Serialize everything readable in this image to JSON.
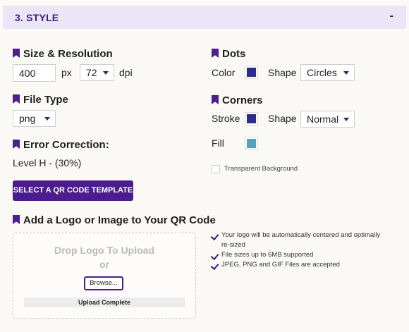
{
  "header": {
    "title": "3. STYLE",
    "collapse": "-"
  },
  "size_resolution": {
    "title": "Size & Resolution",
    "size_value": "400",
    "size_unit": "px",
    "dpi_value": "72",
    "dpi_unit": "dpi"
  },
  "file_type": {
    "title": "File Type",
    "value": "png"
  },
  "error_correction": {
    "title": "Error Correction:",
    "value": "Level H - (30%)"
  },
  "template_button": "SELECT A QR CODE TEMPLATE",
  "dots": {
    "title": "Dots",
    "color_label": "Color",
    "color": "#2e2b8f",
    "shape_label": "Shape",
    "shape_value": "Circles"
  },
  "corners": {
    "title": "Corners",
    "stroke_label": "Stroke",
    "stroke_color": "#2e2b8f",
    "shape_label": "Shape",
    "shape_value": "Normal",
    "fill_label": "Fill",
    "fill_color": "#56a0c0"
  },
  "transparent_background": {
    "label": "Transparent Background",
    "checked": false
  },
  "logo": {
    "title": "Add a Logo or Image to Your QR Code",
    "drop_title": "Drop Logo To Upload",
    "drop_or": "or",
    "browse_label": "Browse...",
    "upload_status": "Upload Complete",
    "info": [
      "Your logo will be automatically centered and optimally re-sized",
      "File sizes up to 6MB supported",
      "JPEG, PNG and GIF Files are accepted"
    ]
  },
  "colors": {
    "accent": "#4b1d8c",
    "header_bg": "#ebe6f7"
  }
}
